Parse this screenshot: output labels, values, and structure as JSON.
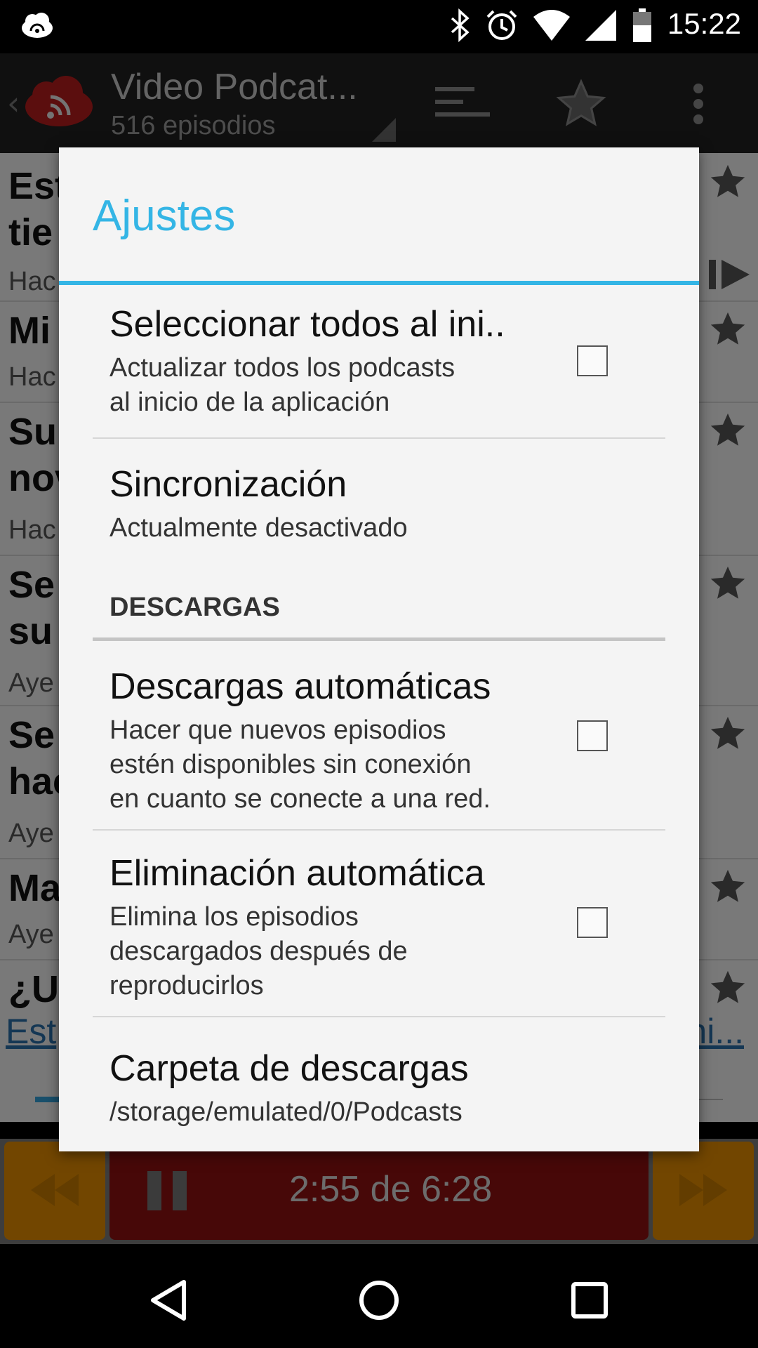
{
  "status_bar": {
    "time": "15:22",
    "icons": [
      "cloud-sync-icon",
      "bluetooth-icon",
      "alarm-icon",
      "wifi-icon",
      "signal-icon",
      "battery-icon"
    ]
  },
  "app_bar": {
    "title": "Video Podcat...",
    "subtitle": "516 episodios",
    "icons": [
      "back-chevron-icon",
      "podcast-logo-icon",
      "sort-icon",
      "star-icon",
      "overflow-menu-icon"
    ]
  },
  "background_list": {
    "rows": [
      {
        "title_lines": [
          "Est",
          "tie"
        ],
        "sub": "Hac"
      },
      {
        "title_lines": [
          "Mi"
        ],
        "sub": "Hac"
      },
      {
        "title_lines": [
          "Su",
          "nov"
        ],
        "sub": "Hac"
      },
      {
        "title_lines": [
          "Se",
          "su"
        ],
        "sub": "Aye"
      },
      {
        "title_lines": [
          "Se",
          "hac"
        ],
        "sub": "Aye"
      },
      {
        "title_lines": [
          "Ma"
        ],
        "sub": "Aye"
      },
      {
        "title_lines": [
          "¿U"
        ],
        "sub": ""
      }
    ],
    "link_left": "Est",
    "link_right": "ni..."
  },
  "player": {
    "time_text": "2:55 de 6:28",
    "progress_fraction": 0.45
  },
  "dialog": {
    "title": "Ajustes",
    "prefs": [
      {
        "title": "Seleccionar todos al ini..",
        "summary": [
          "Actualizar todos los podcasts",
          "al inicio de la aplicación"
        ],
        "checked": false
      },
      {
        "title": "Sincronización",
        "summary": [
          "Actualmente desactivado"
        ]
      },
      {
        "title": "Descargas automáticas",
        "summary": [
          "Hacer que nuevos episodios",
          "estén disponibles sin conexión",
          "en cuanto se conecte a una red."
        ],
        "checked": false
      },
      {
        "title": "Eliminación automática",
        "summary": [
          "Elimina los episodios",
          "descargados después de",
          "reproducirlos"
        ],
        "checked": false
      },
      {
        "title": "Carpeta de descargas",
        "summary": [
          "/storage/emulated/0/Podcasts"
        ]
      }
    ],
    "category_label": "DESCARGAS"
  },
  "nav_bar": {
    "icons": [
      "back-icon",
      "home-icon",
      "recents-icon"
    ]
  },
  "colors": {
    "accent": "#34b5e5",
    "player_orange": "#e58d00",
    "player_red": "#8e1111"
  }
}
